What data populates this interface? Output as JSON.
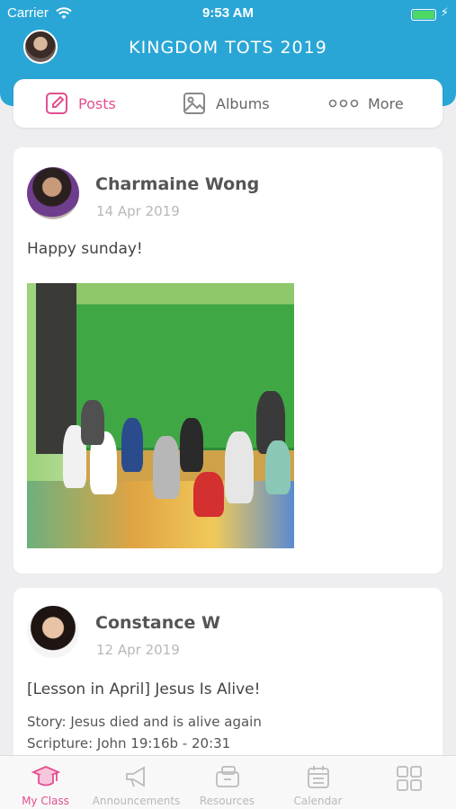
{
  "status": {
    "carrier": "Carrier",
    "time": "9:53 AM",
    "battery_level": 1.0
  },
  "header": {
    "title": "KINGDOM TOTS 2019"
  },
  "tabs": [
    {
      "label": "Posts",
      "icon": "edit-icon",
      "active": true
    },
    {
      "label": "Albums",
      "icon": "image-icon",
      "active": false
    },
    {
      "label": "More",
      "icon": "dots-icon",
      "active": false
    }
  ],
  "posts": [
    {
      "author": "Charmaine Wong",
      "date": "14 Apr 2019",
      "text": "Happy sunday!",
      "has_photo": true
    },
    {
      "author": "Constance W",
      "date": "12 Apr 2019",
      "title": "[Lesson in April] Jesus Is Alive!",
      "lines": [
        "Story: Jesus died and is alive again",
        "Scripture: John 19:16b - 20:31"
      ]
    }
  ],
  "bottom_nav": [
    {
      "label": "My Class",
      "icon": "graduation-cap-icon",
      "active": true
    },
    {
      "label": "Announcements",
      "icon": "megaphone-icon",
      "active": false
    },
    {
      "label": "Resources",
      "icon": "resources-icon",
      "active": false
    },
    {
      "label": "Calendar",
      "icon": "calendar-icon",
      "active": false
    },
    {
      "label": "",
      "icon": "apps-grid-icon",
      "active": false
    }
  ],
  "colors": {
    "header": "#2aa6d6",
    "accent": "#e24f8f",
    "inactive": "#b9b9b9"
  }
}
